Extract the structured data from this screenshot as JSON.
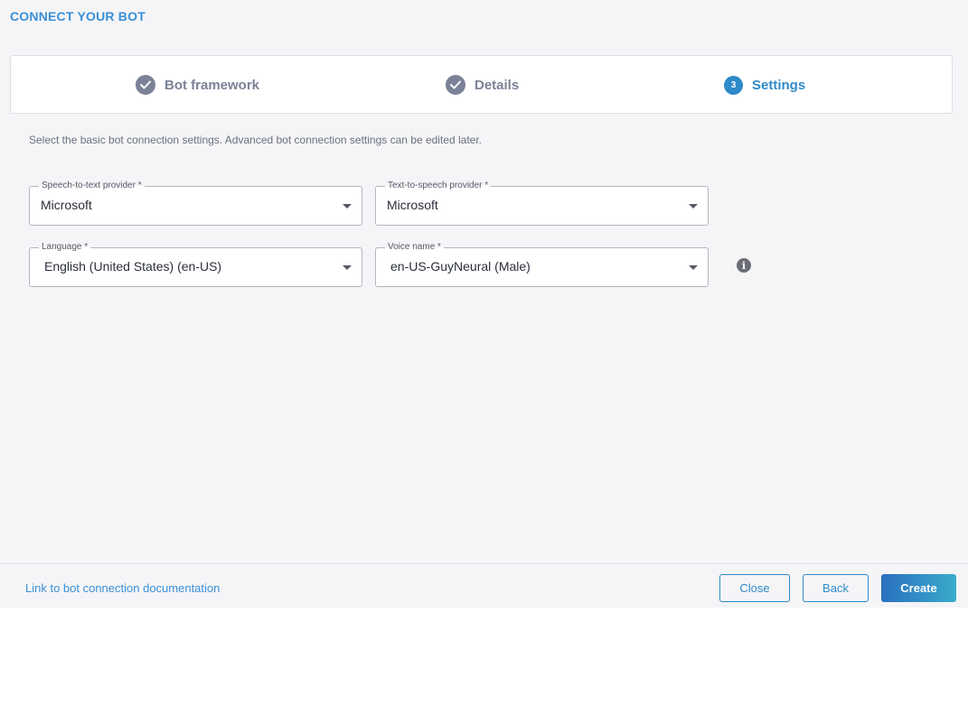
{
  "dialog": {
    "title": "CONNECT YOUR BOT",
    "description": "Select the basic bot connection settings. Advanced bot connection settings can be edited later."
  },
  "stepper": {
    "steps": [
      {
        "label": "Bot framework",
        "state": "done",
        "icon": "check-icon"
      },
      {
        "label": "Details",
        "state": "done",
        "icon": "check-icon"
      },
      {
        "label": "Settings",
        "state": "active",
        "number": "3"
      }
    ]
  },
  "form": {
    "stt_provider": {
      "label": "Speech-to-text provider *",
      "value": "Microsoft"
    },
    "tts_provider": {
      "label": "Text-to-speech provider *",
      "value": "Microsoft"
    },
    "language": {
      "label": "Language *",
      "value": "English (United States) (en-US)"
    },
    "voice_name": {
      "label": "Voice name *",
      "value": "en-US-GuyNeural (Male)"
    },
    "info_icon": "info-icon"
  },
  "footer": {
    "doc_link": "Link to bot connection documentation",
    "close_label": "Close",
    "back_label": "Back",
    "create_label": "Create"
  },
  "colors": {
    "accent": "#2e8ac8",
    "done_step": "#7b8196",
    "background": "#f5f5f7"
  }
}
